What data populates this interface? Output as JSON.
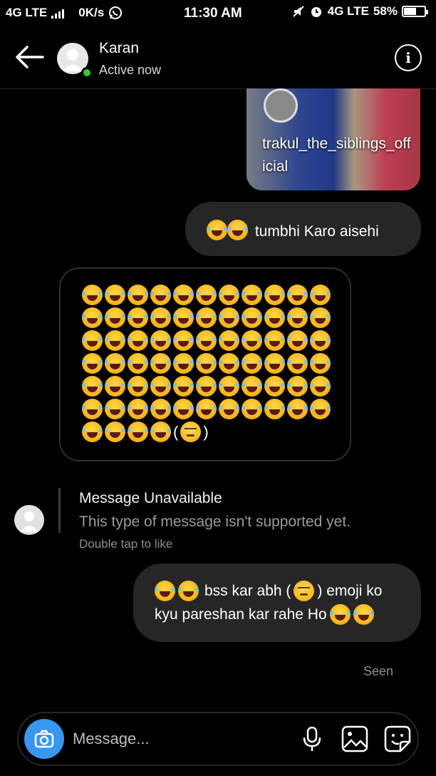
{
  "status": {
    "left_network": "4G LTE",
    "speed": "0K/s",
    "time": "11:30 AM",
    "right_network": "4G LTE",
    "battery": "58%"
  },
  "header": {
    "name": "Karan",
    "status": "Active now",
    "info_glyph": "i"
  },
  "shared_post": {
    "username": "trakul_the_siblings_official"
  },
  "messages": {
    "sent_1": "tumbhi Karo aisehi",
    "emoji_rows": [
      11,
      11,
      11,
      11,
      11,
      11,
      4
    ],
    "emoji_open": "(",
    "emoji_close": ")",
    "unavailable_title": "Message Unavailable",
    "unavailable_sub": "This type of message isn't supported yet.",
    "double_tap": "Double tap to like",
    "sent_2_line1_text": "bss kar abh (",
    "sent_2_line1_tail": ") emoji ko",
    "sent_2_line2": "kyu pareshan kar rahe Ho",
    "seen": "Seen"
  },
  "composer": {
    "placeholder": "Message..."
  },
  "icons": [
    "back-arrow-icon",
    "info-icon",
    "camera-icon",
    "microphone-icon",
    "gallery-icon",
    "sticker-icon",
    "laughing-emoji-icon",
    "unamused-emoji-icon",
    "whatsapp-icon",
    "alarm-icon",
    "mute-icon"
  ]
}
